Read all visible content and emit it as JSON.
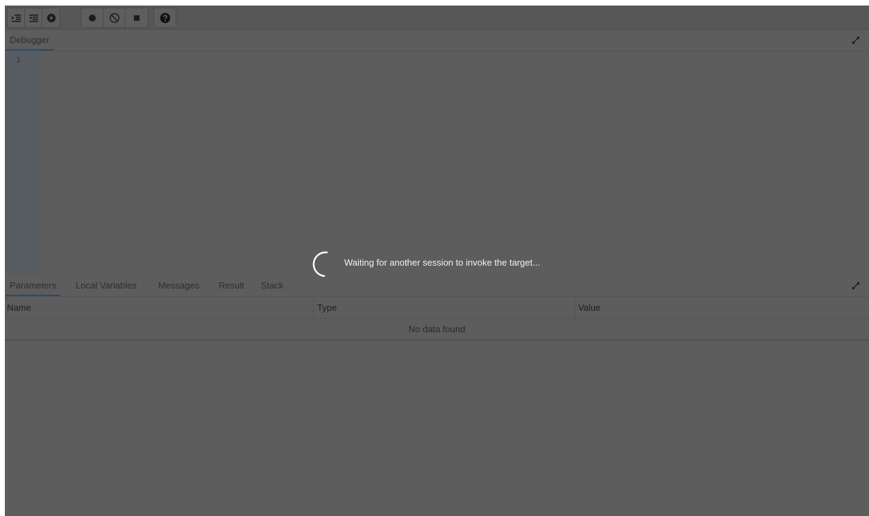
{
  "toolbar": {
    "buttons": [
      {
        "icon": "step-into-icon"
      },
      {
        "icon": "step-over-icon"
      },
      {
        "icon": "continue-icon"
      },
      {
        "icon": "toggle-breakpoint-icon"
      },
      {
        "icon": "clear-breakpoints-icon"
      },
      {
        "icon": "stop-icon"
      },
      {
        "icon": "help-icon"
      }
    ]
  },
  "debugger_panel": {
    "tab_label": "Debugger",
    "line_numbers": [
      "1"
    ],
    "expand_icon": "expand-icon"
  },
  "loading": {
    "message": "Waiting for another session to invoke the target..."
  },
  "bottom_panel": {
    "tabs": [
      "Parameters",
      "Local Variables",
      "Messages",
      "Result",
      "Stack"
    ],
    "active_tab": "Parameters",
    "expand_icon": "expand-icon"
  },
  "table": {
    "columns": [
      "Name",
      "Type",
      "Value"
    ],
    "empty_message": "No data found"
  },
  "colors": {
    "overlay": "#5d5d5d",
    "tab_underline": "#274b6e",
    "gutter": "#575c63"
  }
}
